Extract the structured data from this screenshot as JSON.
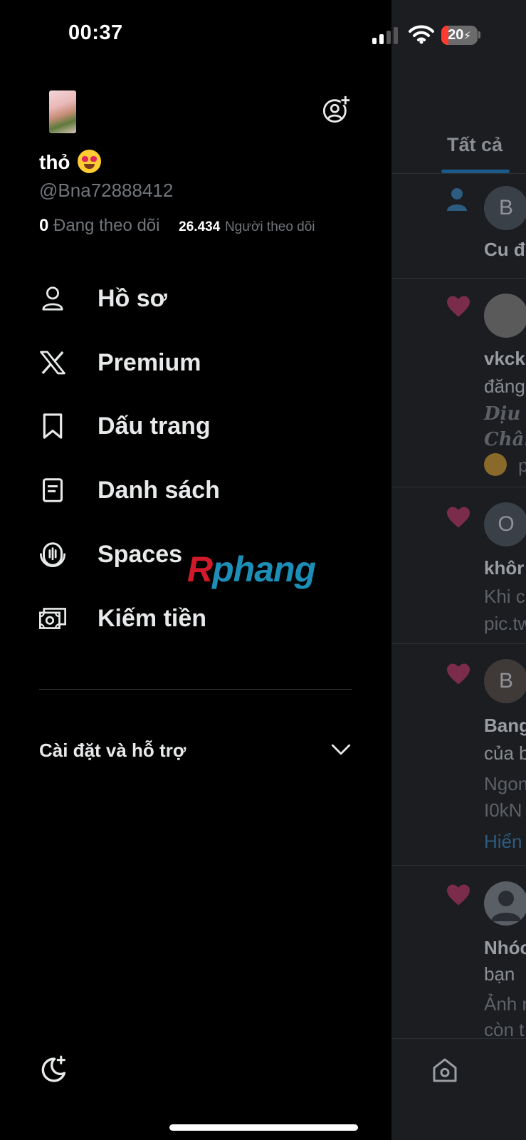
{
  "status_bar": {
    "time": "00:37",
    "battery": "20"
  },
  "profile": {
    "name": "thỏ",
    "handle": "@Bna72888412",
    "following_count": "0",
    "following_label": "Đang theo dõi",
    "followers_count": "26.434",
    "followers_label": "Người theo dõi"
  },
  "menu": [
    {
      "label": "Hồ sơ",
      "icon": "person-icon"
    },
    {
      "label": "Premium",
      "icon": "x-logo-icon"
    },
    {
      "label": "Dấu trang",
      "icon": "bookmark-icon"
    },
    {
      "label": "Danh sách",
      "icon": "list-icon"
    },
    {
      "label": "Spaces",
      "icon": "spaces-icon"
    },
    {
      "label": "Kiếm tiền",
      "icon": "money-icon"
    }
  ],
  "watermark": {
    "part1": "R",
    "part2": "phang"
  },
  "settings": {
    "label": "Cài đặt và hỗ trợ"
  },
  "feed": {
    "tab": "Tất cả",
    "items": [
      {
        "avatar": "B",
        "line1": "Cu đ"
      },
      {
        "line1": "vkck",
        "line2": "đăng",
        "line3": "Dịu c",
        "line4": "Chân",
        "line5": "p"
      },
      {
        "avatar": "O",
        "line1": "khôr",
        "line2": "Khi c",
        "line3": "pic.tw"
      },
      {
        "avatar": "B",
        "line1": "Bang",
        "line2": "của b",
        "line3": "Ngon",
        "line4": "I0kN",
        "line5": "Hiển"
      },
      {
        "line1": "Nhóc",
        "line2": "bạn",
        "line3": "Ảnh r",
        "line4": "còn t"
      }
    ]
  },
  "colors": {
    "accent": "#1d9bf0",
    "background": "#000000",
    "secondary_text": "#71767b"
  }
}
